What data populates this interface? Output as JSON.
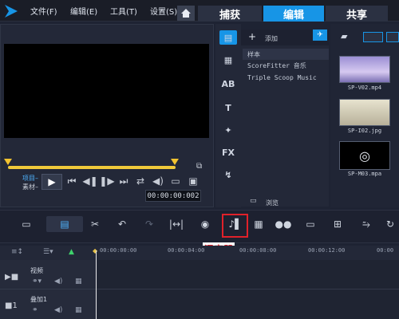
{
  "menubar": {
    "items": [
      "文件(F)",
      "编辑(E)",
      "工具(T)",
      "设置(S)"
    ],
    "tabs": [
      "捕获",
      "编辑",
      "共享"
    ],
    "active_tab": "编辑"
  },
  "preview": {
    "project_label": "项目",
    "clip_label": "素材",
    "timecode": "00:00:00:002",
    "scrub_position": 0.0
  },
  "library": {
    "add_label": "添加",
    "items": [
      "样本",
      "ScoreFitter 音乐",
      "Triple Scoop Music"
    ],
    "browse_label": "浏览"
  },
  "media": {
    "files": [
      "SP-V02.mp4",
      "SP-I02.jpg",
      "SP-M03.mpa"
    ]
  },
  "timeline": {
    "ticks": [
      "00:00:00:00",
      "00:00:04:00",
      "00:00:08:00",
      "00:00:12:00",
      "00:00"
    ],
    "tracks": [
      "视频",
      "叠加1"
    ]
  },
  "annotation": {
    "mixer_label": "混音器",
    "highlight_color": "#e0212a"
  },
  "colors": {
    "accent": "#1795e6",
    "background": "#1e2333",
    "scrub": "#f0c93a"
  }
}
